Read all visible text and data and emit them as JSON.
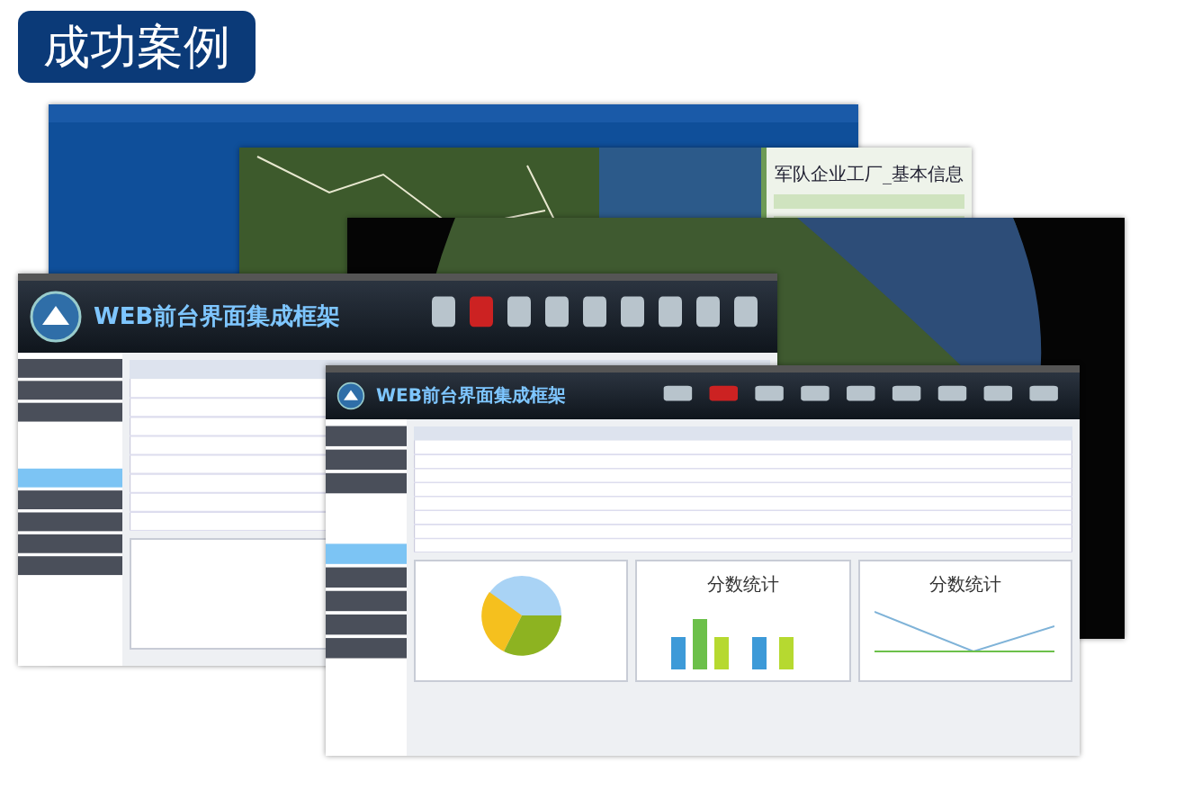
{
  "title": "成功案例",
  "screens": [
    {
      "kind": "map"
    },
    {
      "kind": "satellite",
      "panel_title": "军队企业工厂_基本信息"
    },
    {
      "kind": "globe"
    },
    {
      "kind": "app",
      "app_title": "WEB前台界面集成框架"
    },
    {
      "kind": "app",
      "app_title": "WEB前台界面集成框架",
      "chart_titles": [
        "分数统计",
        "分数统计"
      ]
    }
  ]
}
